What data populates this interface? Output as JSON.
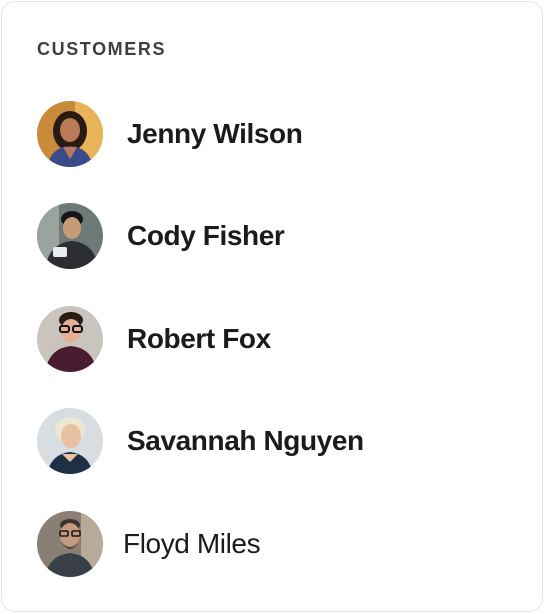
{
  "card": {
    "heading": "CUSTOMERS"
  },
  "customers": [
    {
      "name": "Jenny Wilson",
      "avatar_icon": "woman-portrait-icon"
    },
    {
      "name": "Cody Fisher",
      "avatar_icon": "man-portrait-icon"
    },
    {
      "name": "Robert Fox",
      "avatar_icon": "man-glasses-portrait-icon"
    },
    {
      "name": "Savannah Nguyen",
      "avatar_icon": "woman-portrait-icon"
    },
    {
      "name": "Floyd Miles",
      "avatar_icon": "man-bearded-portrait-icon"
    }
  ],
  "colors": {
    "heading": "#3d3d47",
    "name": "#1a1a1f",
    "border": "#e5e5e5"
  }
}
